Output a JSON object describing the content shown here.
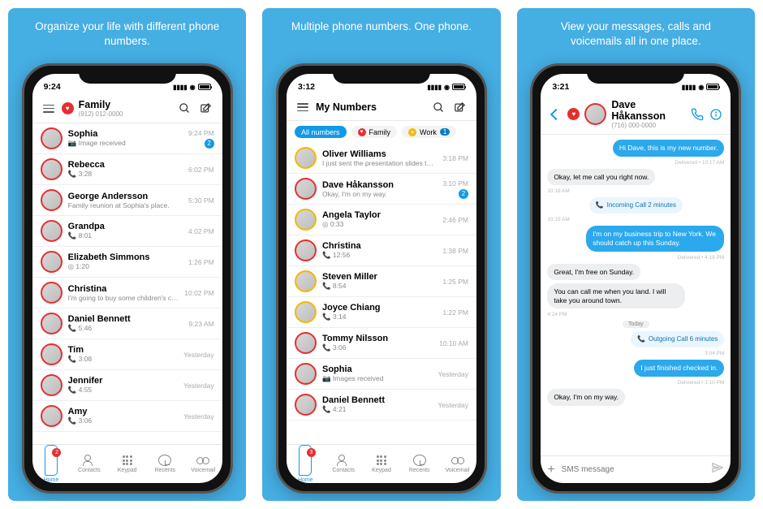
{
  "captions": [
    "Organize your life with different phone numbers.",
    "Multiple phone numbers. One phone.",
    "View your messages, calls and voicemails all in one place."
  ],
  "screen1": {
    "time": "9:24",
    "title": "Family",
    "subtitle": "(912) 012-0000",
    "rows": [
      {
        "name": "Sophia",
        "sub": "📷 Image received",
        "time": "9:24 PM",
        "badge": "2"
      },
      {
        "name": "Rebecca",
        "sub": "📞 3:28",
        "time": "6:02 PM"
      },
      {
        "name": "George Andersson",
        "sub": "Family reunion at Sophia's place.",
        "time": "5:30 PM"
      },
      {
        "name": "Grandpa",
        "sub": "📞 8:01",
        "time": "4:02 PM"
      },
      {
        "name": "Elizabeth Simmons",
        "sub": "◎ 1:20",
        "time": "1:26 PM"
      },
      {
        "name": "Christina",
        "sub": "I'm going to buy some children's cloth after work.",
        "time": "10:02 PM"
      },
      {
        "name": "Daniel Bennett",
        "sub": "📞 5:46",
        "time": "9:23 AM"
      },
      {
        "name": "Tim",
        "sub": "📞 3:08",
        "time": "Yesterday"
      },
      {
        "name": "Jennifer",
        "sub": "📞 4:55",
        "time": "Yesterday"
      },
      {
        "name": "Amy",
        "sub": "📞 3:06",
        "time": "Yesterday"
      }
    ],
    "home_badge": "2"
  },
  "screen2": {
    "time": "3:12",
    "title": "My Numbers",
    "chips": [
      {
        "label": "All numbers",
        "active": true
      },
      {
        "label": "Family",
        "color": "#e52f2f"
      },
      {
        "label": "Work",
        "color": "#f5b800",
        "count": "1"
      }
    ],
    "rows": [
      {
        "name": "Oliver Williams",
        "sub": "I just sent the presentation slides to yo...",
        "time": "3:18 PM",
        "ring": "gold"
      },
      {
        "name": "Dave Håkansson",
        "sub": "Okay, I'm on my way.",
        "time": "3:10 PM",
        "ring": "red",
        "badge": "2"
      },
      {
        "name": "Angela Taylor",
        "sub": "◎ 0:33",
        "time": "2:46 PM",
        "ring": "gold"
      },
      {
        "name": "Christina",
        "sub": "📞 12:56",
        "time": "1:38 PM",
        "ring": "red"
      },
      {
        "name": "Steven Miller",
        "sub": "📞 8:54",
        "time": "1:25 PM",
        "ring": "gold"
      },
      {
        "name": "Joyce Chiang",
        "sub": "📞 3:14",
        "time": "1:22 PM",
        "ring": "gold"
      },
      {
        "name": "Tommy Nilsson",
        "sub": "📞 3:06",
        "time": "10:10 AM",
        "ring": "red"
      },
      {
        "name": "Sophia",
        "sub": "📷 Images received",
        "time": "Yesterday",
        "ring": "red"
      },
      {
        "name": "Daniel Bennett",
        "sub": "📞 4:21",
        "time": "Yesterday",
        "ring": "red"
      }
    ],
    "home_badge": "3"
  },
  "screen3": {
    "time": "3:21",
    "contact_name": "Dave Håkansson",
    "contact_number": "(716) 000-0000",
    "messages": [
      {
        "type": "out",
        "text": "Hi Dave, this is my new number."
      },
      {
        "type": "meta-right",
        "text": "Delivered • 10:17 AM"
      },
      {
        "type": "in",
        "text": "Okay, let me call you right now."
      },
      {
        "type": "meta-left",
        "text": "10:18 AM"
      },
      {
        "type": "call",
        "text": "Incoming Call   2 minutes"
      },
      {
        "type": "meta-left",
        "text": "10:19 AM"
      },
      {
        "type": "out",
        "text": "I'm on my business trip to New York. We should catch up this Sunday."
      },
      {
        "type": "meta-right",
        "text": "Delivered • 4:19 PM"
      },
      {
        "type": "in",
        "text": "Great, I'm free on Sunday."
      },
      {
        "type": "in",
        "text": "You can call me when you land. I will take you around town."
      },
      {
        "type": "meta-left",
        "text": "4:24 PM"
      },
      {
        "type": "sep",
        "text": "Today"
      },
      {
        "type": "call-right",
        "text": "Outgoing Call   6 minutes"
      },
      {
        "type": "meta-right",
        "text": "3:04 PM"
      },
      {
        "type": "out",
        "text": "I just finished checked in."
      },
      {
        "type": "meta-right",
        "text": "Delivered • 3:10 PM"
      },
      {
        "type": "in",
        "text": "Okay, I'm on my way."
      }
    ],
    "input_placeholder": "SMS message"
  },
  "tabs": [
    {
      "id": "home",
      "label": "Home",
      "icon": "chat"
    },
    {
      "id": "contacts",
      "label": "Contacts",
      "icon": "contacts"
    },
    {
      "id": "keypad",
      "label": "Keypad",
      "icon": "keypad"
    },
    {
      "id": "recents",
      "label": "Recents",
      "icon": "recents"
    },
    {
      "id": "voicemail",
      "label": "Voicemail",
      "icon": "vm"
    }
  ]
}
